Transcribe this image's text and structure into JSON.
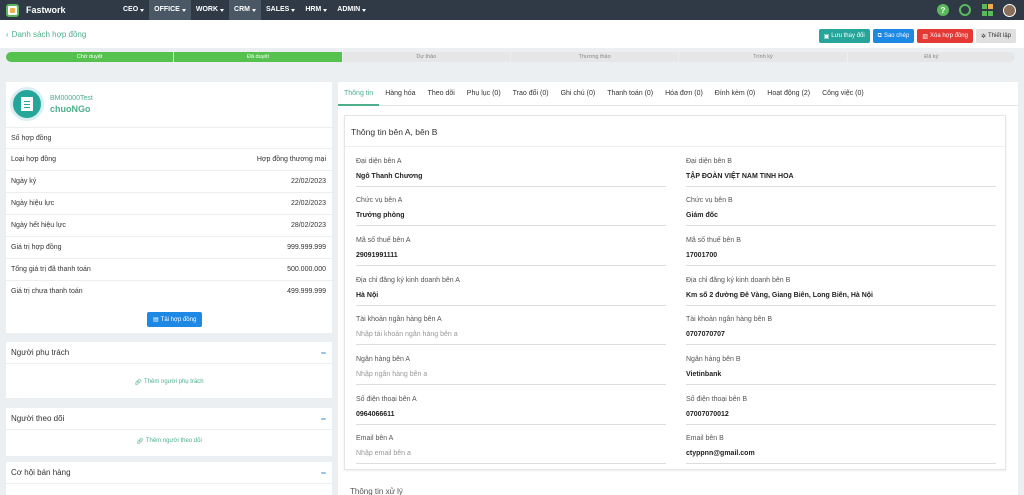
{
  "app": {
    "brand": "Fastwork"
  },
  "nav": [
    "CEO",
    "OFFICE",
    "WORK",
    "CRM",
    "SALES",
    "HRM",
    "ADMIN"
  ],
  "header": {
    "back_label": "Danh sách hợp đồng",
    "actions": {
      "save": "Lưu thay đổi",
      "copy": "Sao chép",
      "delete": "Xóa hợp đồng",
      "settings": "Thiết lập"
    }
  },
  "steps": [
    "Chờ duyệt",
    "Đã duyệt",
    "Dự thảo",
    "Thương thảo",
    "Trình ký",
    "Đã ký"
  ],
  "company": {
    "code": "BM00000Test",
    "name": "chuoNGo"
  },
  "contract_info": [
    {
      "label": "Số hợp đồng",
      "value": ""
    },
    {
      "label": "Loại hợp đồng",
      "value": "Hợp đồng thương mại"
    },
    {
      "label": "Ngày ký",
      "value": "22/02/2023"
    },
    {
      "label": "Ngày hiệu lực",
      "value": "22/02/2023"
    },
    {
      "label": "Ngày hết hiệu lực",
      "value": "28/02/2023"
    },
    {
      "label": "Giá trị hợp đồng",
      "value": "999.999.999"
    },
    {
      "label": "Tổng giá trị đã thanh toán",
      "value": "500.000.000"
    },
    {
      "label": "Giá trị chưa thanh toán",
      "value": "499.999.999"
    }
  ],
  "download_label": "Tải hợp đồng",
  "side_cards": [
    {
      "title": "Người phụ trách",
      "link": "Thêm người phụ trách"
    },
    {
      "title": "Người theo dõi",
      "link": "Thêm người theo dõi"
    },
    {
      "title": "Cơ hội bán hàng"
    }
  ],
  "tabs": [
    "Thông tin",
    "Hàng hóa",
    "Theo dõi",
    "Phụ lục (0)",
    "Trao đổi (0)",
    "Ghi chú (0)",
    "Thanh toán (0)",
    "Hóa đơn (0)",
    "Đính kèm (0)",
    "Hoạt động (2)",
    "Công việc (0)"
  ],
  "section_title": "Thông tin bên A, bên B",
  "party_a": [
    {
      "label": "Đại diện bên A",
      "value": "Ngô Thanh Chương"
    },
    {
      "label": "Chức vụ bên A",
      "value": "Trưởng phòng"
    },
    {
      "label": "Mã số thuế bên A",
      "value": "29091991111"
    },
    {
      "label": "Địa chỉ đăng ký kinh doanh bên A",
      "value": "Hà Nội"
    },
    {
      "label": "Tài khoản ngân hàng bên A",
      "placeholder": "Nhập tài khoản ngân hàng bên a"
    },
    {
      "label": "Ngân hàng bên A",
      "placeholder": "Nhập ngân hàng bên a"
    },
    {
      "label": "Số điện thoại bên A",
      "value": "0964066611"
    },
    {
      "label": "Email bên A",
      "placeholder": "Nhập email bên a"
    }
  ],
  "party_b": [
    {
      "label": "Đại diện bên B",
      "value": "TẬP ĐOÀN VIỆT NAM TINH HOA"
    },
    {
      "label": "Chức vụ bên B",
      "value": "Giám đốc"
    },
    {
      "label": "Mã số thuế bên B",
      "value": "17001700"
    },
    {
      "label": "Địa chỉ đăng ký kinh doanh bên B",
      "value": "Km số 2 đường Đê Vàng, Giang Biên, Long Biên, Hà Nội"
    },
    {
      "label": "Tài khoản ngân hàng bên B",
      "value": "0707070707"
    },
    {
      "label": "Ngân hàng bên B",
      "value": "Vietinbank"
    },
    {
      "label": "Số điện thoại bên B",
      "value": "07007070012"
    },
    {
      "label": "Email bên B",
      "value": "ctyppnn@gmail.com"
    }
  ],
  "section2_title": "Thông tin xử lý"
}
